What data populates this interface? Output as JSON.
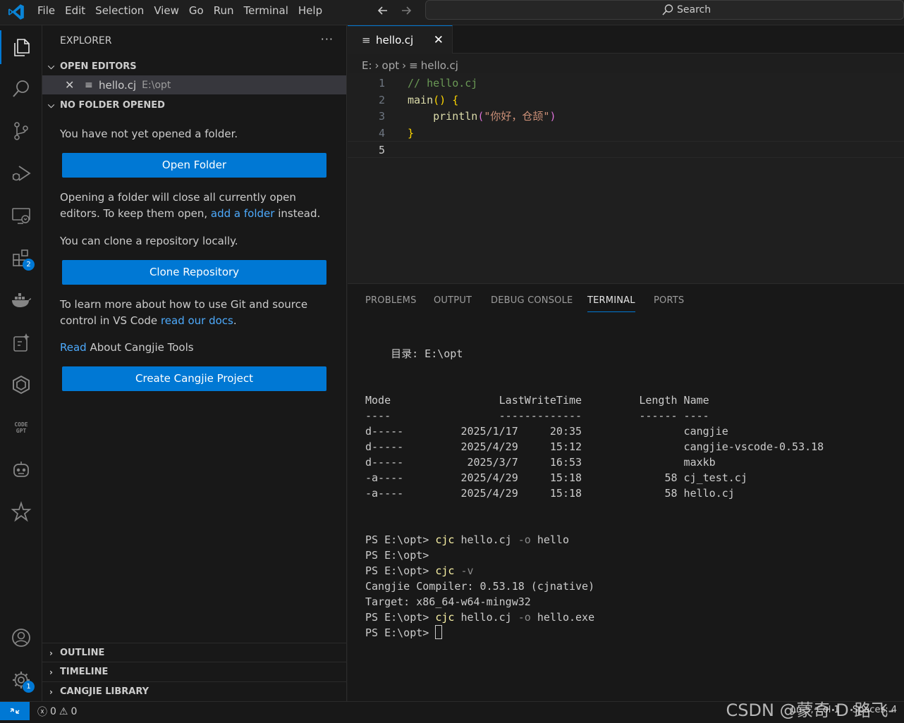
{
  "menubar": [
    "File",
    "Edit",
    "Selection",
    "View",
    "Go",
    "Run",
    "Terminal",
    "Help"
  ],
  "search": {
    "label": "Search"
  },
  "sidebar": {
    "title": "EXPLORER",
    "more": "···",
    "open_editors": {
      "header": "OPEN EDITORS",
      "file": {
        "name": "hello.cj",
        "path": "E:\\opt"
      }
    },
    "no_folder": {
      "header": "NO FOLDER OPENED",
      "msg1": "You have not yet opened a folder.",
      "open_folder_btn": "Open Folder",
      "msg2a": "Opening a folder will close all currently open editors. To keep them open, ",
      "msg2_link": "add a folder",
      "msg2b": " instead.",
      "msg3": "You can clone a repository locally.",
      "clone_btn": "Clone Repository",
      "msg4a": "To learn more about how to use Git and source control in VS Code ",
      "msg4_link": "read our docs",
      "msg4b": ".",
      "read_link": "Read",
      "read_text": " About Cangjie Tools",
      "create_btn": "Create Cangjie Project"
    },
    "bottom_sections": [
      "OUTLINE",
      "TIMELINE",
      "CANGJIE LIBRARY"
    ]
  },
  "activity": {
    "extensions_badge": "2",
    "settings_badge": "1"
  },
  "editor": {
    "tab": {
      "name": "hello.cj"
    },
    "breadcrumb": {
      "drive": "E:",
      "folder": "opt",
      "file": "hello.cj"
    },
    "lines": [
      {
        "n": "1",
        "parts": [
          {
            "t": "// hello.cj",
            "c": "c-comment"
          }
        ]
      },
      {
        "n": "2",
        "parts": [
          {
            "t": "main",
            "c": "c-func"
          },
          {
            "t": "() ",
            "c": "c-bracket1"
          },
          {
            "t": "{",
            "c": "c-bracket1"
          }
        ]
      },
      {
        "n": "3",
        "parts": [
          {
            "t": "    ",
            "c": "c-plain"
          },
          {
            "t": "println",
            "c": "c-func"
          },
          {
            "t": "(",
            "c": "c-bracket2"
          },
          {
            "t": "\"你好，仓颉\"",
            "c": "c-string"
          },
          {
            "t": ")",
            "c": "c-bracket2"
          }
        ]
      },
      {
        "n": "4",
        "parts": [
          {
            "t": "}",
            "c": "c-bracket1"
          }
        ]
      },
      {
        "n": "5",
        "parts": []
      }
    ]
  },
  "panel": {
    "tabs": [
      "PROBLEMS",
      "OUTPUT",
      "DEBUG CONSOLE",
      "TERMINAL",
      "PORTS"
    ],
    "active_tab": "TERMINAL"
  },
  "terminal": {
    "dir_line": "    目录: E:\\opt",
    "header": "Mode                 LastWriteTime         Length Name",
    "divider": "----                 -------------         ------ ----",
    "rows": [
      "d-----         2025/1/17     20:35                cangjie",
      "d-----         2025/4/29     15:12                cangjie-vscode-0.53.18",
      "d-----          2025/3/7     16:53                maxkb",
      "-a----         2025/4/29     15:18             58 cj_test.cj",
      "-a----         2025/4/29     15:18             58 hello.cj"
    ],
    "commands": [
      {
        "prompt": "PS E:\\opt> ",
        "cmd": "cjc",
        "args": [
          {
            "t": " hello.cj ",
            "c": ""
          },
          {
            "t": "-o",
            "c": "t-dim"
          },
          {
            "t": " hello",
            "c": ""
          }
        ]
      },
      {
        "prompt": "PS E:\\opt>",
        "cmd": "",
        "args": []
      },
      {
        "prompt": "PS E:\\opt> ",
        "cmd": "cjc",
        "args": [
          {
            "t": " -v",
            "c": "t-dim"
          }
        ]
      },
      {
        "output": "Cangjie Compiler: 0.53.18 (cjnative)"
      },
      {
        "output": "Target: x86_64-w64-mingw32"
      },
      {
        "prompt": "PS E:\\opt> ",
        "cmd": "cjc",
        "args": [
          {
            "t": " hello.cj ",
            "c": ""
          },
          {
            "t": "-o",
            "c": "t-dim"
          },
          {
            "t": " hello.exe",
            "c": ""
          }
        ]
      },
      {
        "prompt": "PS E:\\opt> ",
        "cmd": "",
        "args": [],
        "cursor": true
      }
    ]
  },
  "statusbar": {
    "errors": "0",
    "warnings": "0",
    "right_items": [
      "Ln 5, Col 1",
      "Spaces: 4"
    ]
  },
  "watermark": "CSDN @蒙奇·D·路飞-"
}
